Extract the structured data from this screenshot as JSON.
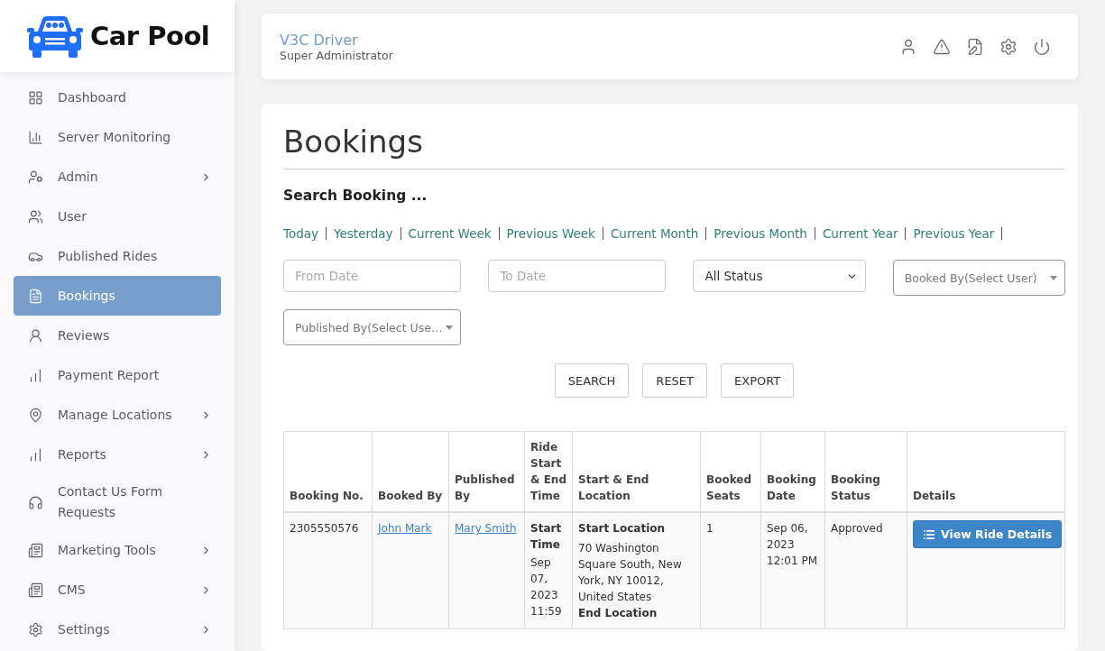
{
  "brand": {
    "name": "Car Pool"
  },
  "sidebar": {
    "items": [
      {
        "label": "Dashboard",
        "selected": false,
        "has_submenu": false
      },
      {
        "label": "Server Monitoring",
        "selected": false,
        "has_submenu": false
      },
      {
        "label": "Admin",
        "selected": false,
        "has_submenu": true
      },
      {
        "label": "User",
        "selected": false,
        "has_submenu": false
      },
      {
        "label": "Published Rides",
        "selected": false,
        "has_submenu": false
      },
      {
        "label": "Bookings",
        "selected": true,
        "has_submenu": false
      },
      {
        "label": "Reviews",
        "selected": false,
        "has_submenu": false
      },
      {
        "label": "Payment Report",
        "selected": false,
        "has_submenu": false
      },
      {
        "label": "Manage Locations",
        "selected": false,
        "has_submenu": true
      },
      {
        "label": "Reports",
        "selected": false,
        "has_submenu": true
      },
      {
        "label": "Contact Us Form Requests",
        "selected": false,
        "has_submenu": false
      },
      {
        "label": "Marketing Tools",
        "selected": false,
        "has_submenu": true
      },
      {
        "label": "CMS",
        "selected": false,
        "has_submenu": true
      },
      {
        "label": "Settings",
        "selected": false,
        "has_submenu": true
      }
    ]
  },
  "header": {
    "user_name": "V3C Driver",
    "role": "Super Administrator"
  },
  "page": {
    "title": "Bookings",
    "search_heading": "Search Booking ...",
    "date_filters": [
      "Today",
      "Yesterday",
      "Current Week",
      "Previous Week",
      "Current Month",
      "Previous Month",
      "Current Year",
      "Previous Year"
    ],
    "from_date": {
      "placeholder": "From Date"
    },
    "to_date": {
      "placeholder": "To Date"
    },
    "status_select": {
      "value": "All Status"
    },
    "booked_by_select": {
      "placeholder": "Booked By(Select User)"
    },
    "published_by_select": {
      "placeholder": "Published By(Select Use…"
    },
    "buttons": [
      "SEARCH",
      "RESET",
      "EXPORT"
    ]
  },
  "table": {
    "columns": [
      "Booking No.",
      "Booked By",
      "Published By",
      "Ride Start & End Time",
      "Start & End Location",
      "Booked Seats",
      "Booking Date",
      "Booking Status",
      "Details"
    ],
    "rows": [
      {
        "booking_no": "2305550576",
        "booked_by": "John Mark",
        "published_by": "Mary Smith",
        "start_time_label": "Start Time",
        "start_time": "Sep 07, 2023 11:59",
        "start_location_label": "Start Location",
        "start_location": "70 Washington Square South, New York, NY 10012, United States",
        "end_location_label": "End Location",
        "booked_seats": "1",
        "booking_date": "Sep 06, 2023 12:01 PM",
        "booking_status": "Approved",
        "details_button": "View Ride Details"
      }
    ]
  }
}
